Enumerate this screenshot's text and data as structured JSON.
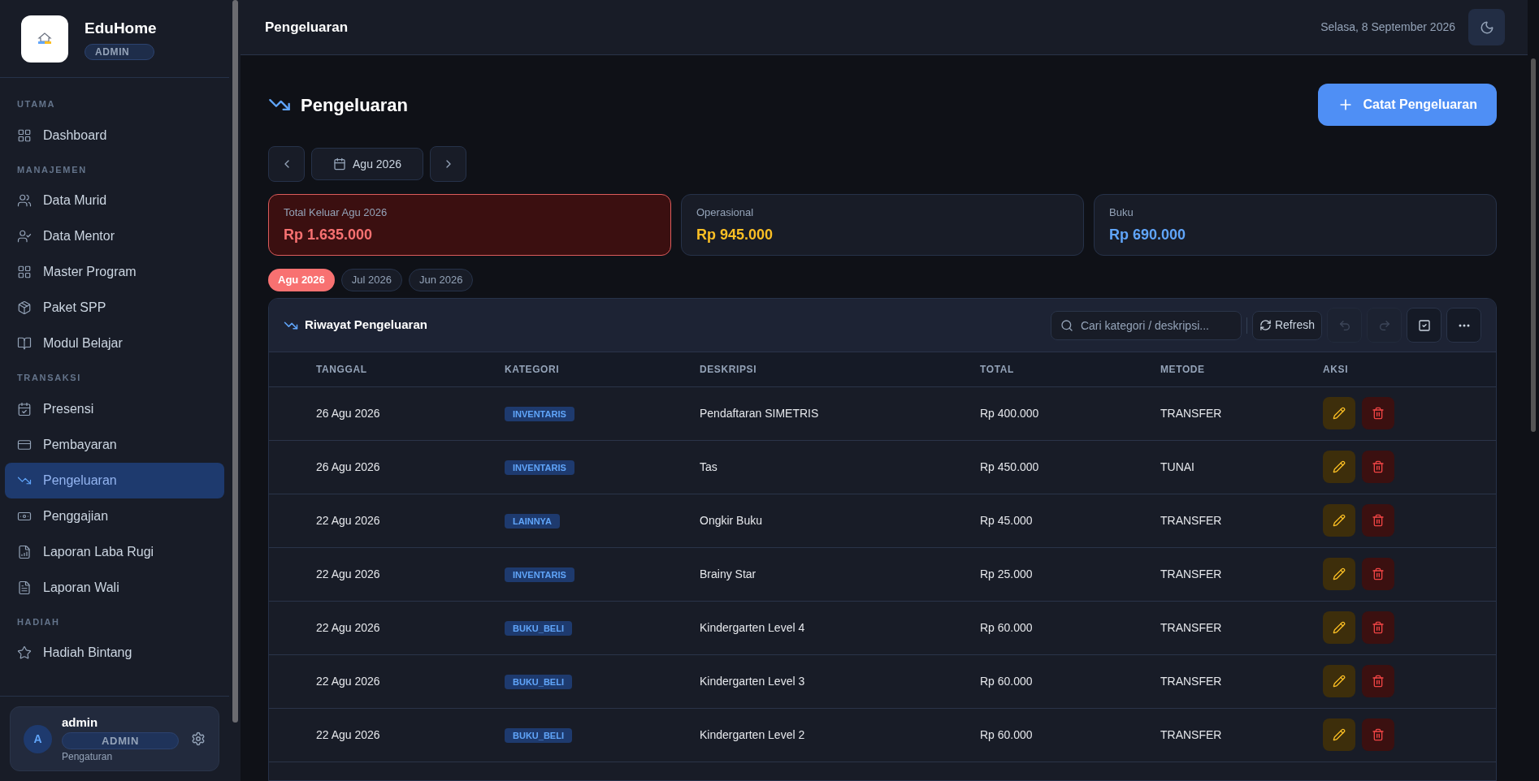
{
  "brand": {
    "name": "EduHome",
    "role": "ADMIN"
  },
  "sidebar": {
    "sections": [
      {
        "title": "UTAMA",
        "items": [
          {
            "kind": "dashboard",
            "label": "Dashboard",
            "selected": false
          }
        ]
      },
      {
        "title": "MANAJEMEN",
        "items": [
          {
            "kind": "users",
            "label": "Data Murid",
            "selected": false
          },
          {
            "kind": "mentor",
            "label": "Data Mentor",
            "selected": false
          },
          {
            "kind": "grid",
            "label": "Master Program",
            "selected": false
          },
          {
            "kind": "package",
            "label": "Paket SPP",
            "selected": false
          },
          {
            "kind": "book",
            "label": "Modul Belajar",
            "selected": false
          }
        ]
      },
      {
        "title": "TRANSAKSI",
        "items": [
          {
            "kind": "calendar",
            "label": "Presensi",
            "selected": false
          },
          {
            "kind": "card",
            "label": "Pembayaran",
            "selected": false
          },
          {
            "kind": "trend",
            "label": "Pengeluaran",
            "selected": true
          },
          {
            "kind": "cash",
            "label": "Penggajian",
            "selected": false
          },
          {
            "kind": "file",
            "label": "Laporan Laba Rugi",
            "selected": false
          },
          {
            "kind": "doc",
            "label": "Laporan Wali",
            "selected": false
          }
        ]
      },
      {
        "title": "HADIAH",
        "items": [
          {
            "kind": "star",
            "label": "Hadiah Bintang",
            "selected": false
          }
        ]
      }
    ]
  },
  "user": {
    "initial": "A",
    "name": "admin",
    "role": "ADMIN",
    "link": "Pengaturan"
  },
  "header": {
    "title": "Pengeluaran",
    "date": "Selasa, 8 September 2026"
  },
  "page": {
    "title": "Pengeluaran",
    "add_button": "Catat Pengeluaran",
    "month": "Agu 2026"
  },
  "summary": [
    {
      "kind": "total",
      "label": "Total Keluar Agu 2026",
      "value": "Rp 1.635.000",
      "color": "#f87171"
    },
    {
      "kind": "category",
      "label": "Operasional",
      "value": "Rp 945.000",
      "color": "#fbbf24"
    },
    {
      "kind": "category",
      "label": "Buku",
      "value": "Rp 690.000",
      "color": "#60a5fa"
    }
  ],
  "month_chips": [
    {
      "label": "Agu 2026",
      "selected": true
    },
    {
      "label": "Jul 2026",
      "selected": false
    },
    {
      "label": "Jun 2026",
      "selected": false
    }
  ],
  "table": {
    "title": "Riwayat Pengeluaran",
    "search_placeholder": "Cari kategori / deskripsi...",
    "refresh": "Refresh",
    "tools": [
      {
        "kind": "undo",
        "disabled": true
      },
      {
        "kind": "redo",
        "disabled": true
      },
      {
        "kind": "check",
        "disabled": false
      },
      {
        "kind": "more",
        "disabled": false
      }
    ],
    "columns": [
      "TANGGAL",
      "KATEGORI",
      "DESKRIPSI",
      "TOTAL",
      "METODE",
      "AKSI"
    ],
    "rows": [
      {
        "date": "26 Agu 2026",
        "category": "INVENTARIS",
        "description": "Pendaftaran SIMETRIS",
        "total": "Rp 400.000",
        "method": "TRANSFER"
      },
      {
        "date": "26 Agu 2026",
        "category": "INVENTARIS",
        "description": "Tas",
        "total": "Rp 450.000",
        "method": "TUNAI"
      },
      {
        "date": "22 Agu 2026",
        "category": "LAINNYA",
        "description": "Ongkir Buku",
        "total": "Rp 45.000",
        "method": "TRANSFER"
      },
      {
        "date": "22 Agu 2026",
        "category": "INVENTARIS",
        "description": "Brainy Star",
        "total": "Rp 25.000",
        "method": "TRANSFER"
      },
      {
        "date": "22 Agu 2026",
        "category": "BUKU_BELI",
        "description": "Kindergarten Level 4",
        "total": "Rp 60.000",
        "method": "TRANSFER"
      },
      {
        "date": "22 Agu 2026",
        "category": "BUKU_BELI",
        "description": "Kindergarten Level 3",
        "total": "Rp 60.000",
        "method": "TRANSFER"
      },
      {
        "date": "22 Agu 2026",
        "category": "BUKU_BELI",
        "description": "Kindergarten Level 2",
        "total": "Rp 60.000",
        "method": "TRANSFER"
      }
    ]
  }
}
